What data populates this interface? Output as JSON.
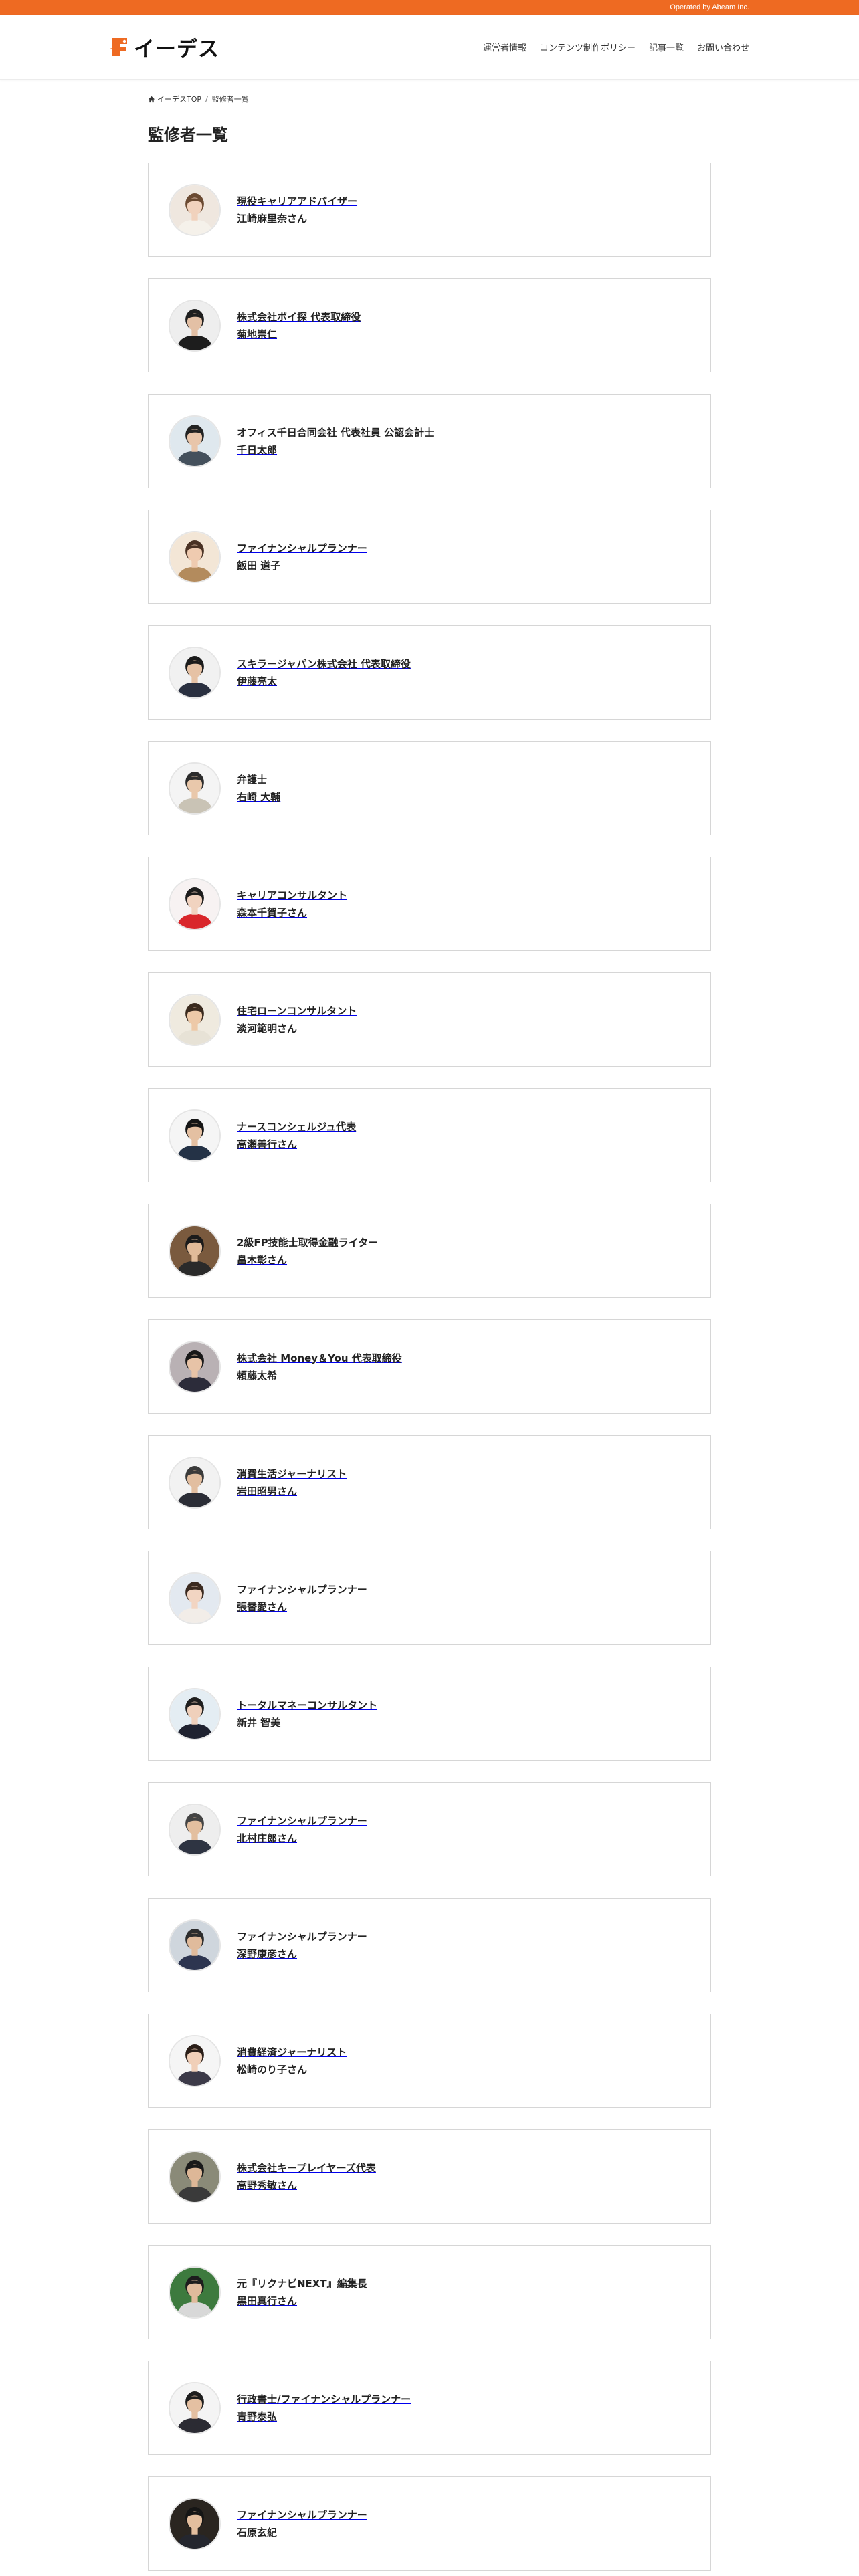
{
  "topbar": {
    "operated_by": "Operated by Abeam Inc."
  },
  "header": {
    "logo_text": "イーデス",
    "nav": [
      {
        "label": "運営者情報"
      },
      {
        "label": "コンテンツ制作ポリシー"
      },
      {
        "label": "記事一覧"
      },
      {
        "label": "お問い合わせ"
      }
    ]
  },
  "breadcrumb": {
    "home_label": "イーデスTOP",
    "separator": "/",
    "current": "監修者一覧"
  },
  "page": {
    "title": "監修者一覧"
  },
  "colors": {
    "accent": "#ee6a22",
    "card_border": "#d6d6d6",
    "text": "#222222"
  },
  "supervisors": [
    {
      "role": "現役キャリアアドバイザー",
      "name": "江崎麻里奈さん",
      "bg": "#efe7df",
      "skin": "#f1d2bd",
      "hair": "#6b4a32",
      "shirt": "#f5f1ea"
    },
    {
      "role": "株式会社ポイ探 代表取締役",
      "name": "菊地崇仁",
      "bg": "#eeeeee",
      "skin": "#e3c0a5",
      "hair": "#1e1e1e",
      "shirt": "#1d1d1d"
    },
    {
      "role": "オフィス千日合同会社 代表社員 公認会計士",
      "name": "千日太郎",
      "bg": "#dfe8ee",
      "skin": "#e8c5aa",
      "hair": "#222222",
      "shirt": "#44505c"
    },
    {
      "role": "ファイナンシャルプランナー",
      "name": "飯田 道子",
      "bg": "#f3e6d6",
      "skin": "#efcbb0",
      "hair": "#4a3224",
      "shirt": "#b38b5d"
    },
    {
      "role": "スキラージャパン株式会社 代表取締役",
      "name": "伊藤亮太",
      "bg": "#f1f1f1",
      "skin": "#e6c2a5",
      "hair": "#1b1b1b",
      "shirt": "#2a3040"
    },
    {
      "role": "弁護士",
      "name": "右崎 大輔",
      "bg": "#f4f4f4",
      "skin": "#e9c8ab",
      "hair": "#2b2b2b",
      "shirt": "#c9c3b5"
    },
    {
      "role": "キャリアコンサルタント",
      "name": "森本千賀子さん",
      "bg": "#f7f2f2",
      "skin": "#f1d3c0",
      "hair": "#1c1c1c",
      "shirt": "#d9262b"
    },
    {
      "role": "住宅ローンコンサルタント",
      "name": "淡河範明さん",
      "bg": "#efeadf",
      "skin": "#edc9a8",
      "hair": "#3a2a1e",
      "shirt": "#e7e2d6"
    },
    {
      "role": "ナースコンシェルジュ代表",
      "name": "高瀬善行さん",
      "bg": "#f5f5f5",
      "skin": "#e4c0a2",
      "hair": "#151515",
      "shirt": "#243246"
    },
    {
      "role": "2級FP技能士取得金融ライター",
      "name": "畠木彰さん",
      "bg": "#7a5a3e",
      "skin": "#e1bb99",
      "hair": "#1b1b1b",
      "shirt": "#2a2a2a"
    },
    {
      "role": "株式会社 Money＆You 代表取締役",
      "name": "頼藤太希",
      "bg": "#b9b1b4",
      "skin": "#e7c3a7",
      "hair": "#181818",
      "shirt": "#2c2c3a"
    },
    {
      "role": "消費生活ジャーナリスト",
      "name": "岩田昭男さん",
      "bg": "#f2f2f2",
      "skin": "#e2bea0",
      "hair": "#3a3a3a",
      "shirt": "#2b2d36"
    },
    {
      "role": "ファイナンシャルプランナー",
      "name": "張替愛さん",
      "bg": "#e3e9f0",
      "skin": "#f2d5c2",
      "hair": "#3b2a20",
      "shirt": "#f2ede8"
    },
    {
      "role": "トータルマネーコンサルタント",
      "name": "新井 智美",
      "bg": "#e4edf3",
      "skin": "#efd0bb",
      "hair": "#1f1f1f",
      "shirt": "#1f2230"
    },
    {
      "role": "ファイナンシャルプランナー",
      "name": "北村庄郎さん",
      "bg": "#eeeeee",
      "skin": "#e3bf9f",
      "hair": "#444444",
      "shirt": "#2e3442"
    },
    {
      "role": "ファイナンシャルプランナー",
      "name": "深野康彦さん",
      "bg": "#cfd6dd",
      "skin": "#e0bb9c",
      "hair": "#2c2c2c",
      "shirt": "#2d3550"
    },
    {
      "role": "消費経済ジャーナリスト",
      "name": "松崎のり子さん",
      "bg": "#f5f5f5",
      "skin": "#f0cfb8",
      "hair": "#2a1e18",
      "shirt": "#3c3a48"
    },
    {
      "role": "株式会社キープレイヤーズ代表",
      "name": "高野秀敏さん",
      "bg": "#8a8a78",
      "skin": "#ddb797",
      "hair": "#1a1a1a",
      "shirt": "#3a3a3a"
    },
    {
      "role": "元『リクナビNEXT』編集長",
      "name": "黒田真行さん",
      "bg": "#3d7a3e",
      "skin": "#e0bb9c",
      "hair": "#1d1d1d",
      "shirt": "#d8d8d8"
    },
    {
      "role": "行政書士/ファイナンシャルプランナー",
      "name": "青野泰弘",
      "bg": "#f4f4f4",
      "skin": "#e4c0a2",
      "hair": "#1d1d1d",
      "shirt": "#2b2b33"
    },
    {
      "role": "ファイナンシャルプランナー",
      "name": "石原玄紀",
      "bg": "#2a2520",
      "skin": "#e3be9e",
      "hair": "#151515",
      "shirt": "#24262e"
    }
  ]
}
